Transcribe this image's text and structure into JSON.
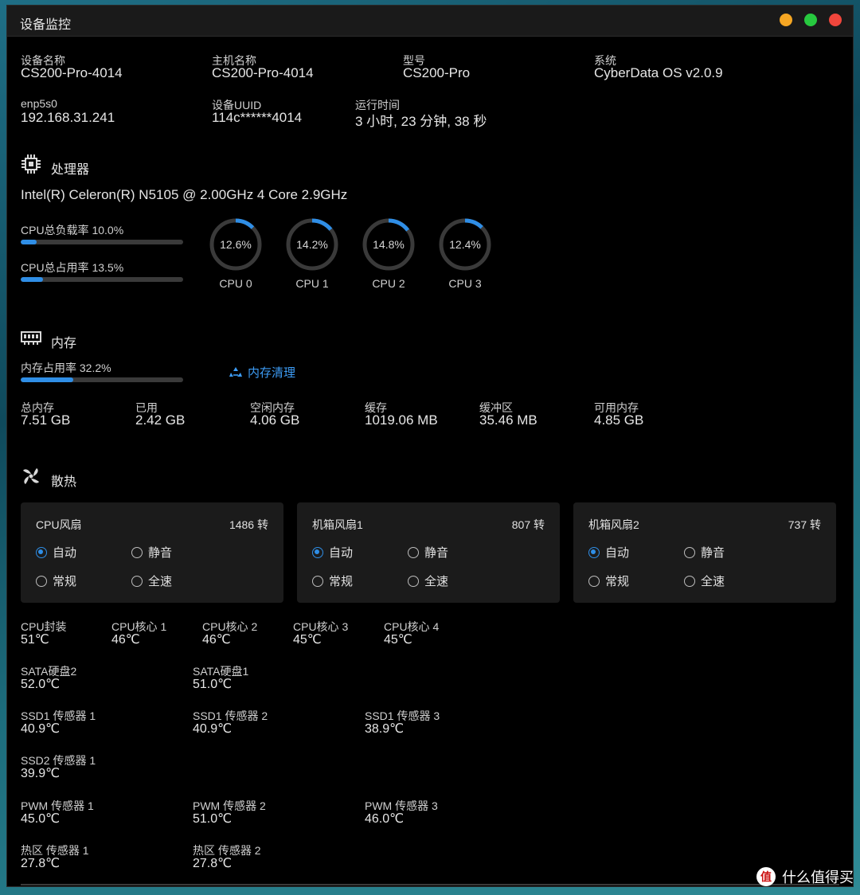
{
  "window": {
    "title": "设备监控"
  },
  "device": {
    "row1": [
      {
        "label": "设备名称",
        "value": "CS200-Pro-4014"
      },
      {
        "label": "主机名称",
        "value": "CS200-Pro-4014"
      },
      {
        "label": "型号",
        "value": "CS200-Pro"
      },
      {
        "label": "系统",
        "value": "CyberData OS v2.0.9"
      }
    ],
    "row2": [
      {
        "label": "enp5s0",
        "value": "192.168.31.241"
      },
      {
        "label": "设备UUID",
        "value": "114c******4014"
      },
      {
        "label": "运行时间",
        "value": "3 小时, 23 分钟, 38 秒"
      }
    ]
  },
  "cpu": {
    "section_title": "处理器",
    "model": "Intel(R) Celeron(R) N5105 @ 2.00GHz 4 Core 2.9GHz",
    "load_label": "CPU总负载率 10.0%",
    "load_value": 10.0,
    "usage_label": "CPU总占用率 13.5%",
    "usage_value": 13.5,
    "cores": [
      {
        "name": "CPU 0",
        "text": "12.6%",
        "value": 12.6
      },
      {
        "name": "CPU 1",
        "text": "14.2%",
        "value": 14.2
      },
      {
        "name": "CPU 2",
        "text": "14.8%",
        "value": 14.8
      },
      {
        "name": "CPU 3",
        "text": "12.4%",
        "value": 12.4
      }
    ]
  },
  "memory": {
    "section_title": "内存",
    "usage_label": "内存占用率 32.2%",
    "usage_value": 32.2,
    "clean_button": "内存清理",
    "stats": [
      {
        "label": "总内存",
        "value": "7.51 GB"
      },
      {
        "label": "已用",
        "value": "2.42 GB"
      },
      {
        "label": "空闲内存",
        "value": "4.06 GB"
      },
      {
        "label": "缓存",
        "value": "1019.06 MB"
      },
      {
        "label": "缓冲区",
        "value": "35.46 MB"
      },
      {
        "label": "可用内存",
        "value": "4.85 GB"
      }
    ]
  },
  "cooling": {
    "section_title": "散热",
    "fans": [
      {
        "name": "CPU风扇",
        "rpm": "1486 转",
        "selected": 0
      },
      {
        "name": "机箱风扇1",
        "rpm": "807 转",
        "selected": 0
      },
      {
        "name": "机箱风扇2",
        "rpm": "737 转",
        "selected": 0
      }
    ],
    "fan_modes": [
      "自动",
      "静音",
      "常规",
      "全速"
    ],
    "temp_rows": [
      [
        {
          "label": "CPU封装",
          "value": "51℃"
        },
        {
          "label": "CPU核心 1",
          "value": "46℃"
        },
        {
          "label": "CPU核心 2",
          "value": "46℃"
        },
        {
          "label": "CPU核心 3",
          "value": "45℃"
        },
        {
          "label": "CPU核心 4",
          "value": "45℃"
        }
      ],
      [
        {
          "label": "SATA硬盘2",
          "value": "52.0℃"
        },
        {
          "label": "SATA硬盘1",
          "value": "51.0℃"
        }
      ],
      [
        {
          "label": "SSD1 传感器 1",
          "value": "40.9℃"
        },
        {
          "label": "SSD1 传感器 2",
          "value": "40.9℃"
        },
        {
          "label": "SSD1 传感器 3",
          "value": "38.9℃"
        }
      ],
      [
        {
          "label": "SSD2 传感器 1",
          "value": "39.9℃"
        }
      ],
      [
        {
          "label": "PWM 传感器 1",
          "value": "45.0℃"
        },
        {
          "label": "PWM 传感器 2",
          "value": "51.0℃"
        },
        {
          "label": "PWM 传感器 3",
          "value": "46.0℃"
        }
      ],
      [
        {
          "label": "热区 传感器 1",
          "value": "27.8℃"
        },
        {
          "label": "热区 传感器 2",
          "value": "27.8℃"
        }
      ]
    ]
  },
  "watermark": {
    "logo": "值",
    "text": "什么值得买"
  },
  "colors": {
    "accent": "#2f8ee6",
    "track": "#3a3a3a",
    "card": "#1b1b1b"
  }
}
